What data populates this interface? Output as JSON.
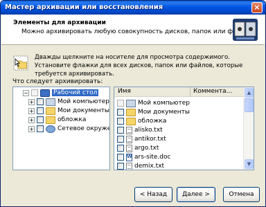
{
  "window": {
    "title": "Мастер архивации или восстановления",
    "close_label": "×"
  },
  "header": {
    "title": "Элементы для архивации",
    "subtitle": "Можно архивировать любую совокупность дисков, папок или файлов."
  },
  "info": {
    "text": "Дважды щелкните на носителе для просмотра содержимого. Установите флажки для всех дисков, папок или файлов, которые требуется архивировать."
  },
  "tree": {
    "label": "Что следует архивировать:",
    "items": [
      {
        "label": "Рабочий стол",
        "icon": "desktop-icon",
        "expander": "−",
        "selected": true
      },
      {
        "label": "Мой компьютер",
        "icon": "computer-icon",
        "expander": "+"
      },
      {
        "label": "Мои документы",
        "icon": "folder-icon",
        "expander": "+"
      },
      {
        "label": "обложка",
        "icon": "folder-icon",
        "expander": "+"
      },
      {
        "label": "Сетевое окружение",
        "icon": "network-icon",
        "expander": "+"
      }
    ]
  },
  "list": {
    "columns": {
      "name": "Имя",
      "comment": "Коммента..."
    },
    "items": [
      {
        "label": "Мой компьютер",
        "icon": "computer-icon"
      },
      {
        "label": "Мои документы",
        "icon": "folder-icon"
      },
      {
        "label": "обложка",
        "icon": "folder-icon"
      },
      {
        "label": "alisko.txt",
        "icon": "text-file-icon"
      },
      {
        "label": "antikor.txt",
        "icon": "text-file-icon"
      },
      {
        "label": "argo.txt",
        "icon": "text-file-icon"
      },
      {
        "label": "ars-site.doc",
        "icon": "word-doc-icon"
      },
      {
        "label": "demix.txt",
        "icon": "text-file-icon"
      }
    ]
  },
  "buttons": {
    "back": "< Назад",
    "next": "Далее >",
    "cancel": "Отмена"
  },
  "colors": {
    "title_bar": "#0054e3",
    "selection": "#316ac5",
    "dialog_bg": "#ece9d8"
  }
}
